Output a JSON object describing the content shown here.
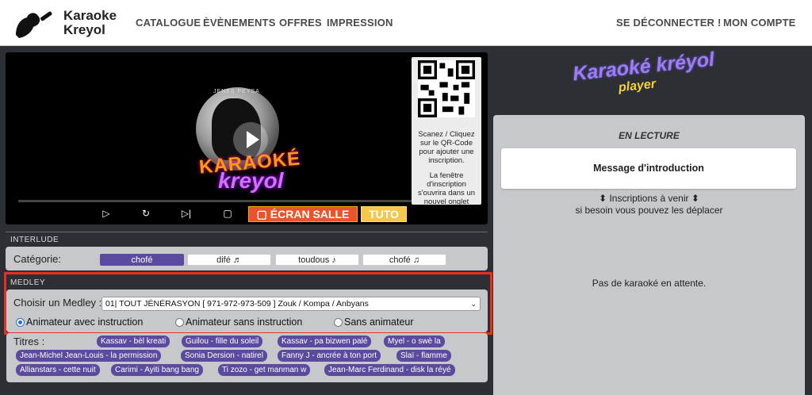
{
  "header": {
    "brand_line1": "Karaoke",
    "brand_line2": "Kreyol",
    "nav_left": [
      "CATALOGUE",
      "ÈVÈNEMENTS",
      "OFFRES",
      "IMPRESSION"
    ],
    "nav_right": [
      "SE DÉCONNECTER !",
      "MON COMPTE"
    ]
  },
  "video": {
    "logo_top": "JENES PEYSA",
    "logo_word1": "KARAOKÉ",
    "logo_word2": "kreyol",
    "qr_text": "Scanez / Cliquez sur le QR-Code pour ajouter une inscription.",
    "qr_text2": "La fenêtre d'inscription s'ouvrira dans un nouvel onglet",
    "progress_fraction": 0.0,
    "ecran_label": "▢ ÉCRAN SALLE",
    "tuto_label": "TUTO"
  },
  "interlude": {
    "section_label": "INTERLUDE",
    "category_label": "Catégorie:",
    "categories": [
      "chofé",
      "difé ♬",
      "toudous ♪",
      "chofé ♫"
    ]
  },
  "medley": {
    "section_label": "MEDLEY",
    "choose_label": "Choisir un Medley :",
    "selected": "01| TOUT JÉNÉRASYON [ 971-972-973-509 ] Zouk / Kompa / Anbyans",
    "radios": [
      "Animateur avec instruction",
      "Animateur sans instruction",
      "Sans animateur"
    ],
    "titres_label": "Titres :",
    "titres": [
      "Kassav - bèl kreati",
      "Guilou - fille du soleil",
      "Kassav - pa bizwen palé",
      "Myel - o swè la",
      "Jean-Michel Jean-Louis - la permission",
      "Sonia Dersion - natirel",
      "Fanny J - ancrée à ton port",
      "Slaï - flamme",
      "Allianstars - cette nuit",
      "Carimi - Ayiti bang bang",
      "Ti zozo - get manman w",
      "Jean-Marc Ferdinand - disk la réyé"
    ]
  },
  "player": {
    "title": "Karaoké kréyol",
    "subtitle": "player",
    "en_lecture": "EN LECTURE",
    "message": "Message d'introduction",
    "inscriptions": "⬍ Inscriptions à venir ⬍",
    "deplacer": "si besoin vous pouvez les déplacer",
    "attente": "Pas de karaoké en attente."
  }
}
